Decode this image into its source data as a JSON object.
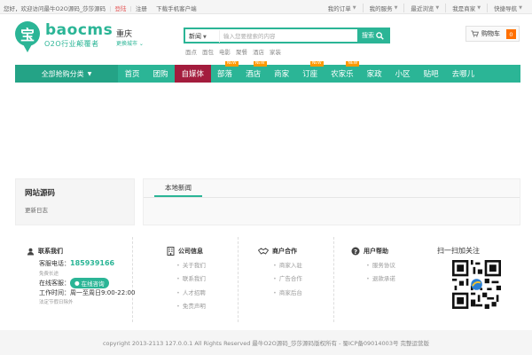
{
  "topbar": {
    "welcome": "您好，欢迎访问最牛O2O源码_莎莎源码",
    "login": "登陆",
    "register": "注册",
    "app": "下载手机客户端",
    "links": [
      "我的订单",
      "我的服务",
      "最近浏览",
      "我是商家",
      "快捷导航"
    ]
  },
  "header": {
    "logo_char": "宝",
    "logo_text": "baocms",
    "slogan": "O2O行业颠覆者",
    "city": "重庆",
    "city_switch": "更换城市"
  },
  "search": {
    "type": "新闻",
    "placeholder": "输入您要搜索的内容",
    "button": "搜索",
    "hot_words": [
      "面点",
      "面包",
      "电影",
      "聚餐",
      "酒店",
      "家装"
    ]
  },
  "cart": {
    "label": "购物车",
    "count": "0"
  },
  "nav": {
    "all_categories": "全部抢购分类",
    "items": [
      {
        "label": "首页",
        "new": false
      },
      {
        "label": "团购",
        "new": false
      },
      {
        "label": "自媒体",
        "new": false,
        "active": true
      },
      {
        "label": "部落",
        "new": true
      },
      {
        "label": "酒店",
        "new": true
      },
      {
        "label": "商家",
        "new": false
      },
      {
        "label": "订座",
        "new": true
      },
      {
        "label": "农家乐",
        "new": true
      },
      {
        "label": "家政",
        "new": false
      },
      {
        "label": "小区",
        "new": false
      },
      {
        "label": "贴吧",
        "new": false
      },
      {
        "label": "去哪儿",
        "new": false
      }
    ],
    "new_badge": "NEW",
    "colors": {
      "nav": "#2bb596",
      "active": "#a31c3d",
      "badge": "#ff9900"
    }
  },
  "sidebar": {
    "title": "网站源码",
    "link": "更新日志"
  },
  "news": {
    "tab": "本地新闻"
  },
  "footer": {
    "contact": {
      "title": "联系我们",
      "phone_label": "客服电话：",
      "phone": "185939166",
      "phone_note": "免费长途",
      "online_label": "在线客服：",
      "online_btn": "在线咨询",
      "hours": "工作时间：周一至周日9:00-22:00",
      "hours_note": "法定节假日除外"
    },
    "company": {
      "title": "公司信息",
      "links": [
        "关于我们",
        "联系我们",
        "人才招聘",
        "免责声明"
      ]
    },
    "partner": {
      "title": "商户合作",
      "links": [
        "商家入驻",
        "广告合作",
        "商家后台"
      ]
    },
    "help": {
      "title": "用户帮助",
      "links": [
        "服务协议",
        "退款承诺"
      ]
    },
    "qr_title": "扫一扫加关注"
  },
  "copyright": "copyright 2013-2113 127.0.0.1 All Rights Reserved 最牛O2O源码_莎莎源码版权所有 - 蜀ICP备09014003号 完整运营版"
}
